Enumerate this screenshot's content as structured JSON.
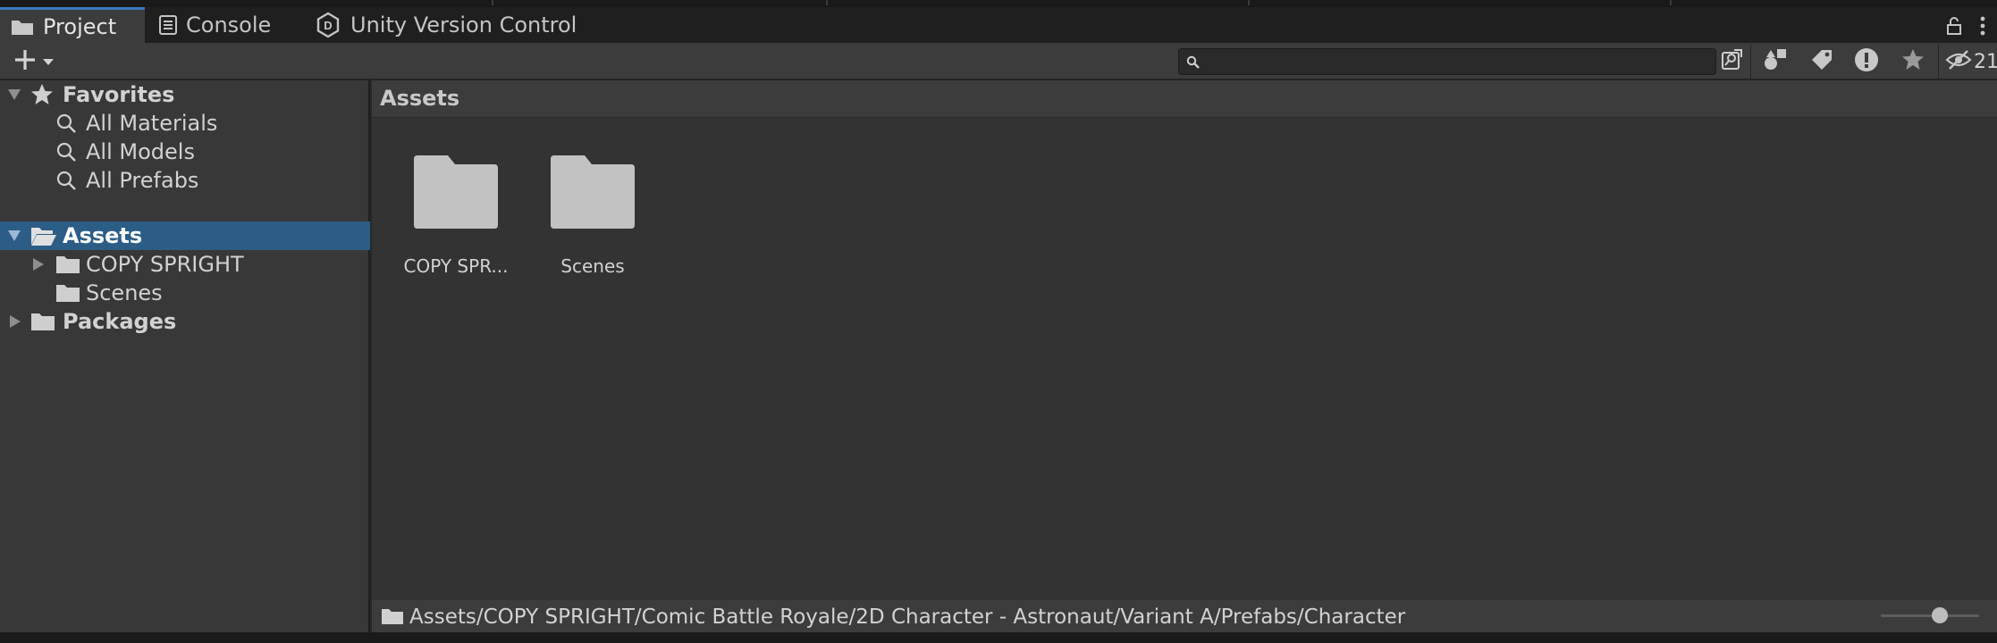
{
  "tabs": [
    {
      "label": "Project",
      "icon": "folder-icon",
      "active": true
    },
    {
      "label": "Console",
      "icon": "console-icon",
      "active": false
    },
    {
      "label": "Unity Version Control",
      "icon": "version-control-icon",
      "active": false
    }
  ],
  "toolbar": {
    "add_icon": "plus-icon",
    "search_placeholder": "",
    "search_value": "",
    "hidden_count": "21"
  },
  "sidebar": {
    "favorites": {
      "label": "Favorites",
      "items": [
        {
          "label": "All Materials"
        },
        {
          "label": "All Models"
        },
        {
          "label": "All Prefabs"
        }
      ]
    },
    "assets": {
      "label": "Assets",
      "children": [
        {
          "label": "COPY SPRIGHT",
          "expandable": true
        },
        {
          "label": "Scenes",
          "expandable": false
        }
      ]
    },
    "packages": {
      "label": "Packages"
    }
  },
  "main": {
    "title": "Assets",
    "items": [
      {
        "label": "COPY SPR..."
      },
      {
        "label": "Scenes"
      }
    ]
  },
  "status": {
    "path": "Assets/COPY SPRIGHT/Comic Battle Royale/2D Character - Astronaut/Variant A/Prefabs/Character",
    "zoom_fraction": 0.6
  },
  "colors": {
    "selection": "#2c5d87",
    "accent": "#3a79bb",
    "folder": "#c2c2c2"
  }
}
